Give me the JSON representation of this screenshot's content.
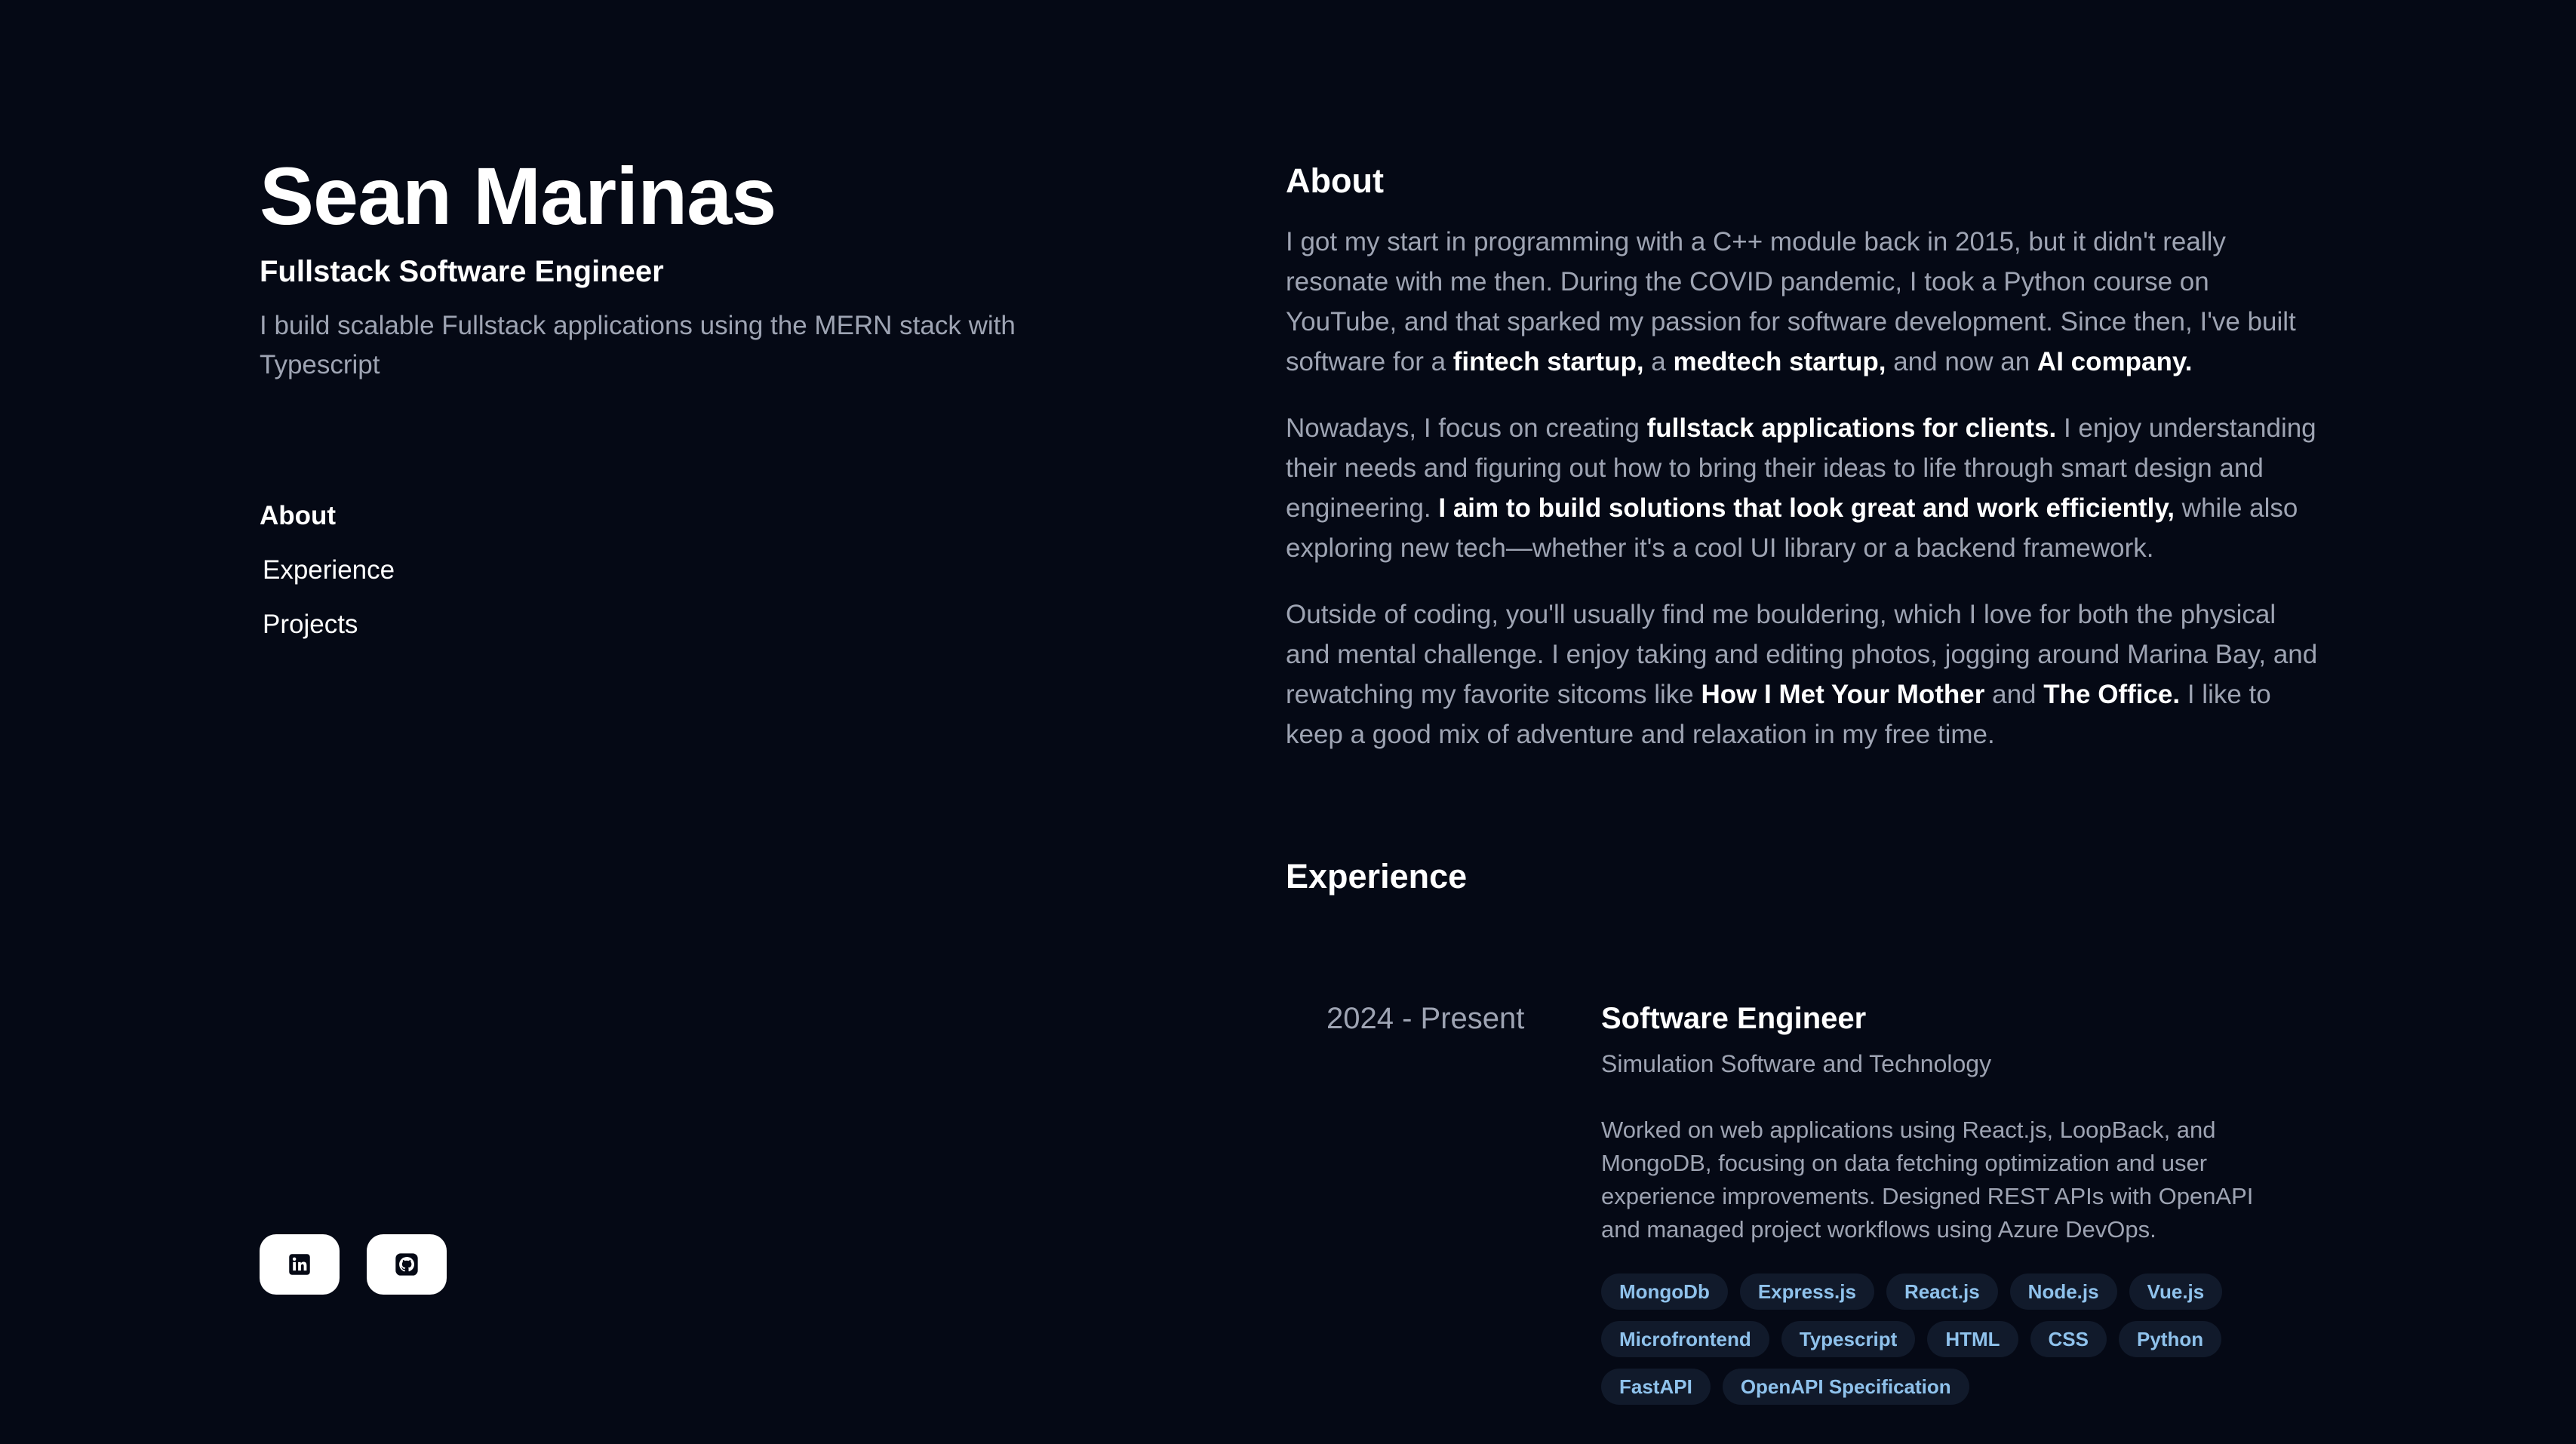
{
  "profile": {
    "name": "Sean Marinas",
    "role": "Fullstack Software Engineer",
    "tagline": "I build scalable Fullstack applications using the MERN stack with Typescript"
  },
  "nav": {
    "items": [
      {
        "label": "About"
      },
      {
        "label": "Experience"
      },
      {
        "label": "Projects"
      }
    ],
    "active": "About"
  },
  "socials": [
    {
      "icon": "linkedin-icon"
    },
    {
      "icon": "github-icon"
    }
  ],
  "about": {
    "title": "About",
    "p1": {
      "text1": "I got my start in programming with a C++ module back in 2015, but it didn't really resonate with me then. During the COVID pandemic, I took a Python course on YouTube, and that sparked my passion for software development. Since then, I've built software for a ",
      "bold1": "fintech startup,",
      "text2": " a ",
      "bold2": "medtech startup,",
      "text3": " and now an ",
      "bold3": "AI company."
    },
    "p2": {
      "text1": "Nowadays, I focus on creating ",
      "bold1": "fullstack applications for clients.",
      "text2": " I enjoy understanding their needs and figuring out how to bring their ideas to life through smart design and engineering. ",
      "bold2": "I aim to build solutions that look great and work efficiently,",
      "text3": " while also exploring new tech—whether it's a cool UI library or a backend framework."
    },
    "p3": {
      "text1": "Outside of coding, you'll usually find me bouldering, which I love for both the physical and mental challenge. I enjoy taking and editing photos, jogging around Marina Bay, and rewatching my favorite sitcoms like ",
      "bold1": "How I Met Your Mother",
      "text2": " and ",
      "bold2": "The Office.",
      "text3": " I like to keep a good mix of adventure and relaxation in my free time."
    }
  },
  "experience": {
    "title": "Experience",
    "items": [
      {
        "date": "2024 - Present",
        "role": "Software Engineer",
        "company": "Simulation Software and Technology",
        "description": "Worked on web applications using React.js, LoopBack, and MongoDB, focusing on data fetching optimization and user experience improvements. Designed REST APIs with OpenAPI and managed project workflows using Azure DevOps.",
        "tags": [
          "MongoDb",
          "Express.js",
          "React.js",
          "Node.js",
          "Vue.js",
          "Microfrontend",
          "Typescript",
          "HTML",
          "CSS",
          "Python",
          "FastAPI",
          "OpenAPI Specification"
        ]
      }
    ]
  },
  "colors": {
    "background": "#050915",
    "muted_text": "#9ea4b3",
    "tag_bg": "#111a2b",
    "tag_text": "#8fc2ec"
  }
}
